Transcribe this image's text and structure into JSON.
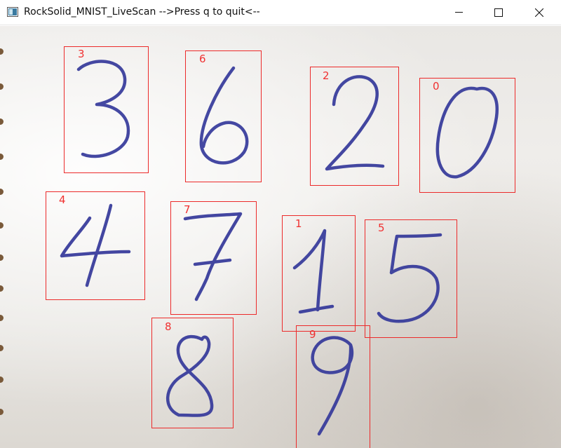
{
  "window": {
    "title": "RockSolid_MNIST_LiveScan -->Press q to quit<--",
    "icon": "app-window-icon",
    "controls": [
      "minimize-icon",
      "maximize-icon",
      "close-icon"
    ]
  },
  "detections": [
    {
      "label": "3"
    },
    {
      "label": "6"
    },
    {
      "label": "2"
    },
    {
      "label": "0"
    },
    {
      "label": "4"
    },
    {
      "label": "7"
    },
    {
      "label": "1"
    },
    {
      "label": "5"
    },
    {
      "label": "8"
    },
    {
      "label": "9"
    }
  ],
  "colors": {
    "box": "#ec2a2a",
    "ink": "#34389a",
    "paper": "#ebe9e6"
  }
}
